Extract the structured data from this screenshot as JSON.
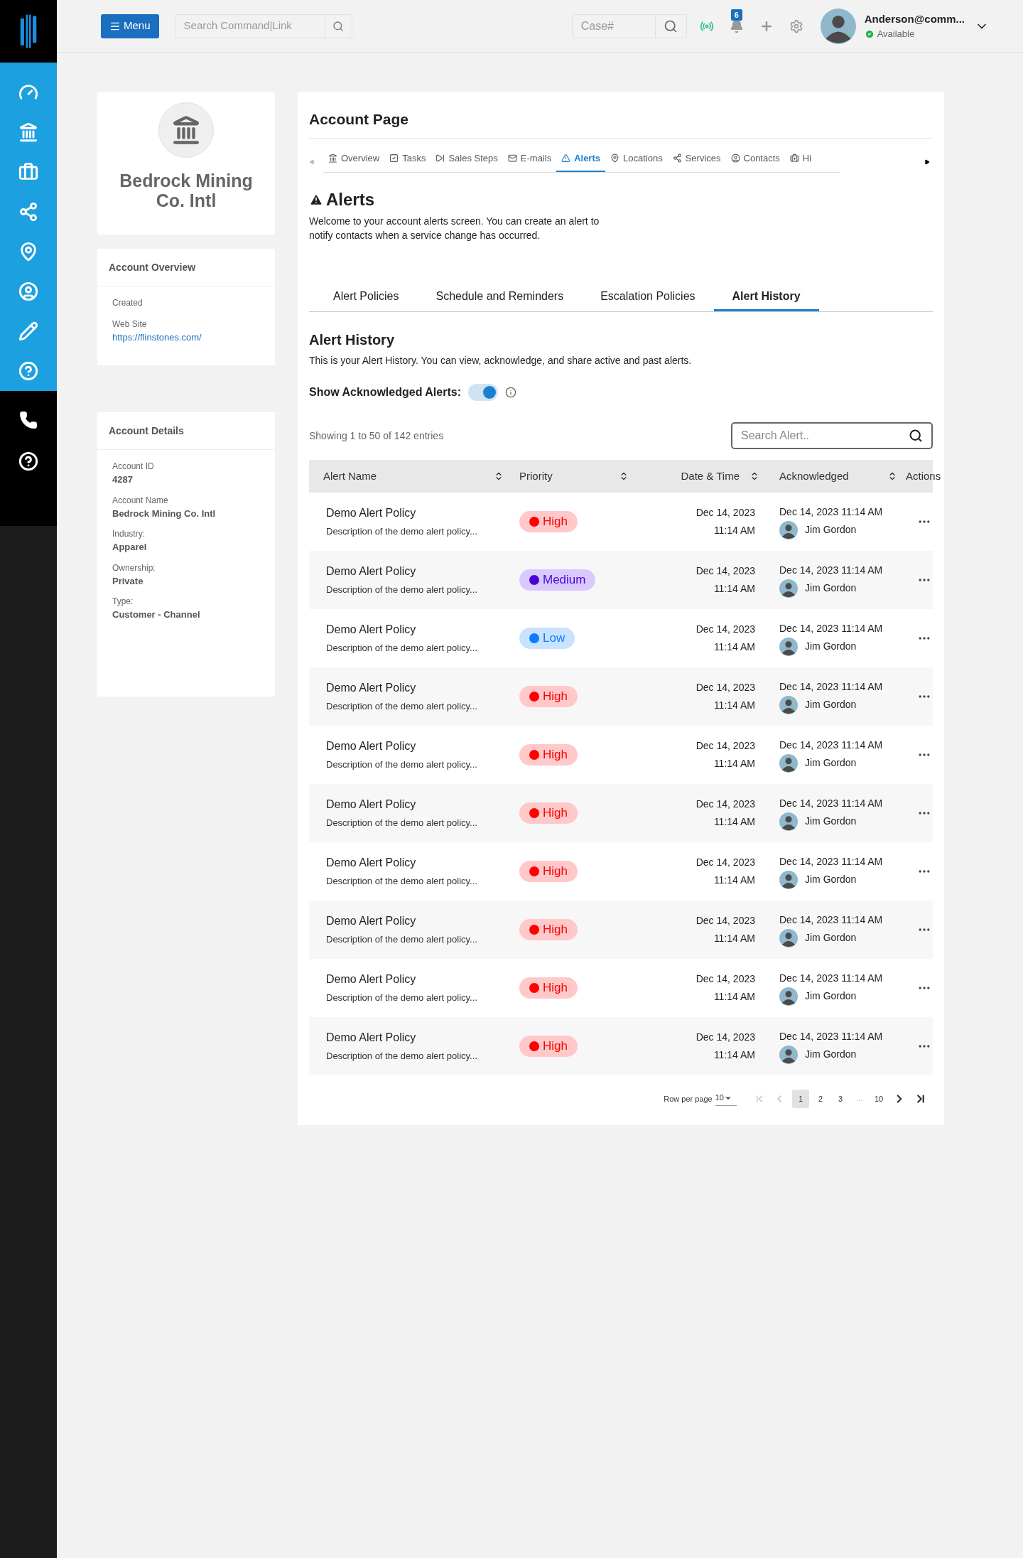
{
  "header": {
    "menu_button": "Menu",
    "search": {
      "placeholder": "Search Command|Link"
    },
    "case_search": {
      "placeholder": "Case#"
    },
    "notifications": {
      "count": "6"
    },
    "user": {
      "name": "Anderson@comm...",
      "status": "Available"
    }
  },
  "account_card": {
    "name": "Bedrock Mining Co. Intl"
  },
  "account_overview": {
    "title": "Account Overview",
    "fields": [
      {
        "label": "Created",
        "kind": "plain"
      },
      {
        "label": "Web Site",
        "value": "https://flinstones.com/",
        "kind": "link"
      }
    ]
  },
  "account_details": {
    "title": "Account Details",
    "fields": [
      {
        "label": "Account ID",
        "value": "4287"
      },
      {
        "label": "Account Name",
        "value": "Bedrock Mining Co. Intl"
      },
      {
        "label": "Industry:",
        "value": "Apparel"
      },
      {
        "label": "Ownership:",
        "value": "Private"
      },
      {
        "label": "Type:",
        "value": "Customer - Channel"
      }
    ]
  },
  "page_title": "Account Page",
  "nav_tabs": [
    {
      "label": "Overview",
      "selected": false
    },
    {
      "label": "Tasks",
      "selected": false
    },
    {
      "label": "Sales Steps",
      "selected": false
    },
    {
      "label": "E-mails",
      "selected": false
    },
    {
      "label": "Alerts",
      "selected": true
    },
    {
      "label": "Locations",
      "selected": false
    },
    {
      "label": "Services",
      "selected": false
    },
    {
      "label": "Contacts",
      "selected": false
    },
    {
      "label": "Hi",
      "selected": false
    }
  ],
  "alerts": {
    "title": "Alerts",
    "description": "Welcome to your account alerts screen. You can create an alert to notify contacts when a service change has occurred."
  },
  "sub_tabs": [
    {
      "label": "Alert Policies",
      "selected": false
    },
    {
      "label": "Schedule and Reminders",
      "selected": false
    },
    {
      "label": "Escalation Policies",
      "selected": false
    },
    {
      "label": "Alert History",
      "selected": true
    }
  ],
  "history": {
    "title": "Alert History",
    "description": "This is your Alert History. You can view, acknowledge, and share active and past alerts.",
    "toggle": {
      "label": "Show Acknowledged Alerts:",
      "on": true
    },
    "showing": "Showing 1 to 50 of 142 entries",
    "search": {
      "placeholder": "Search Alert.."
    }
  },
  "table": {
    "columns": [
      {
        "label": "Alert Name",
        "sortable": true
      },
      {
        "label": "Priority",
        "sortable": true
      },
      {
        "label": "Date & Time",
        "sortable": true
      },
      {
        "label": "Acknowledged",
        "sortable": true
      },
      {
        "label": "Actions",
        "sortable": false
      }
    ],
    "rows": [
      {
        "name": "Demo Alert Policy",
        "description": "Description of the demo alert policy...",
        "priority": {
          "label": "High",
          "kind": "high",
          "color": "#ff0000"
        },
        "date": "Dec 14, 2023",
        "time": "11:14 AM",
        "acknowledged_at": "Dec 14, 2023 11:14 AM",
        "acknowledged_by": "Jim Gordon"
      },
      {
        "name": "Demo Alert Policy",
        "description": "Description of the demo alert policy...",
        "priority": {
          "label": "Medium",
          "kind": "medium",
          "color": "#4b00d9"
        },
        "date": "Dec 14, 2023",
        "time": "11:14 AM",
        "acknowledged_at": "Dec 14, 2023 11:14 AM",
        "acknowledged_by": "Jim Gordon"
      },
      {
        "name": "Demo Alert Policy",
        "description": "Description of the demo alert policy...",
        "priority": {
          "label": "Low",
          "kind": "low",
          "color": "#0a7cff"
        },
        "date": "Dec 14, 2023",
        "time": "11:14 AM",
        "acknowledged_at": "Dec 14, 2023 11:14 AM",
        "acknowledged_by": "Jim Gordon"
      },
      {
        "name": "Demo Alert Policy",
        "description": "Description of the demo alert policy...",
        "priority": {
          "label": "High",
          "kind": "high",
          "color": "#ff0000"
        },
        "date": "Dec 14, 2023",
        "time": "11:14 AM",
        "acknowledged_at": "Dec 14, 2023 11:14 AM",
        "acknowledged_by": "Jim Gordon"
      },
      {
        "name": "Demo Alert Policy",
        "description": "Description of the demo alert policy...",
        "priority": {
          "label": "High",
          "kind": "high",
          "color": "#ff0000"
        },
        "date": "Dec 14, 2023",
        "time": "11:14 AM",
        "acknowledged_at": "Dec 14, 2023 11:14 AM",
        "acknowledged_by": "Jim Gordon"
      },
      {
        "name": "Demo Alert Policy",
        "description": "Description of the demo alert policy...",
        "priority": {
          "label": "High",
          "kind": "high",
          "color": "#ff0000"
        },
        "date": "Dec 14, 2023",
        "time": "11:14 AM",
        "acknowledged_at": "Dec 14, 2023 11:14 AM",
        "acknowledged_by": "Jim Gordon"
      },
      {
        "name": "Demo Alert Policy",
        "description": "Description of the demo alert policy...",
        "priority": {
          "label": "High",
          "kind": "high",
          "color": "#ff0000"
        },
        "date": "Dec 14, 2023",
        "time": "11:14 AM",
        "acknowledged_at": "Dec 14, 2023 11:14 AM",
        "acknowledged_by": "Jim Gordon"
      },
      {
        "name": "Demo Alert Policy",
        "description": "Description of the demo alert policy...",
        "priority": {
          "label": "High",
          "kind": "high",
          "color": "#ff0000"
        },
        "date": "Dec 14, 2023",
        "time": "11:14 AM",
        "acknowledged_at": "Dec 14, 2023 11:14 AM",
        "acknowledged_by": "Jim Gordon"
      },
      {
        "name": "Demo Alert Policy",
        "description": "Description of the demo alert policy...",
        "priority": {
          "label": "High",
          "kind": "high",
          "color": "#ff0000"
        },
        "date": "Dec 14, 2023",
        "time": "11:14 AM",
        "acknowledged_at": "Dec 14, 2023 11:14 AM",
        "acknowledged_by": "Jim Gordon"
      },
      {
        "name": "Demo Alert Policy",
        "description": "Description of the demo alert policy...",
        "priority": {
          "label": "High",
          "kind": "high",
          "color": "#ff0000"
        },
        "date": "Dec 14, 2023",
        "time": "11:14 AM",
        "acknowledged_at": "Dec 14, 2023 11:14 AM",
        "acknowledged_by": "Jim Gordon"
      }
    ]
  },
  "pagination": {
    "rows_label": "Row per page",
    "rows_value": "10",
    "pages": [
      {
        "label": "1",
        "selected": true
      },
      {
        "label": "2",
        "selected": false
      },
      {
        "label": "3",
        "selected": false
      },
      {
        "label": "...",
        "kind": "gap",
        "selected": false
      },
      {
        "label": "10",
        "selected": false
      }
    ]
  }
}
